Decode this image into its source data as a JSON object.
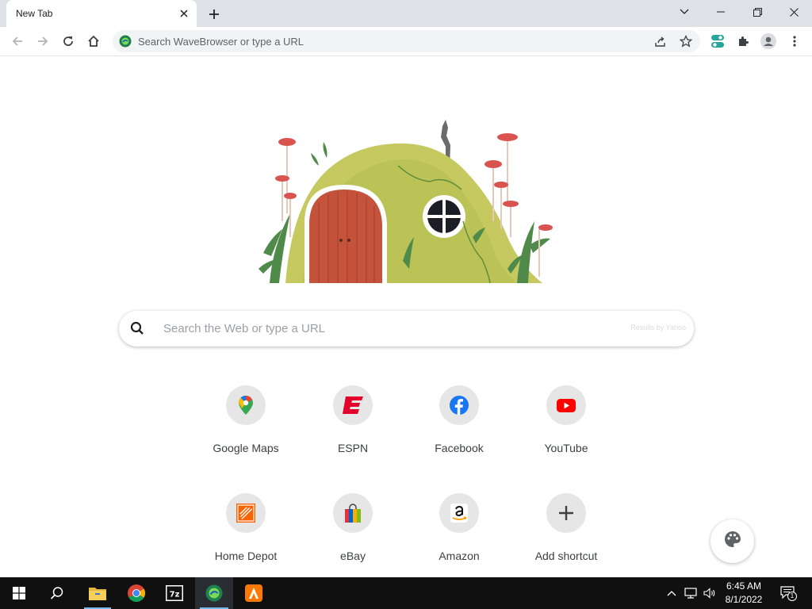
{
  "browser": {
    "tab": {
      "title": "New Tab"
    },
    "omnibox": {
      "placeholder": "Search WaveBrowser or type a URL"
    }
  },
  "page": {
    "search": {
      "placeholder": "Search the Web or type a URL",
      "attribution": "Results by Yahoo"
    },
    "shortcuts": [
      {
        "label": "Google Maps",
        "icon": "google-maps-icon"
      },
      {
        "label": "ESPN",
        "icon": "espn-icon"
      },
      {
        "label": "Facebook",
        "icon": "facebook-icon"
      },
      {
        "label": "YouTube",
        "icon": "youtube-icon"
      },
      {
        "label": "Home Depot",
        "icon": "home-depot-icon"
      },
      {
        "label": "eBay",
        "icon": "ebay-icon"
      },
      {
        "label": "Amazon",
        "icon": "amazon-icon"
      },
      {
        "label": "Add shortcut",
        "icon": "plus-icon"
      }
    ]
  },
  "taskbar": {
    "time": "6:45 AM",
    "date": "8/1/2022",
    "notification_count": "1"
  },
  "colors": {
    "tab_strip": "#dee1e6",
    "omnibox": "#f1f3f4",
    "taskbar": "#101010",
    "accent_teal": "#26a69a"
  }
}
